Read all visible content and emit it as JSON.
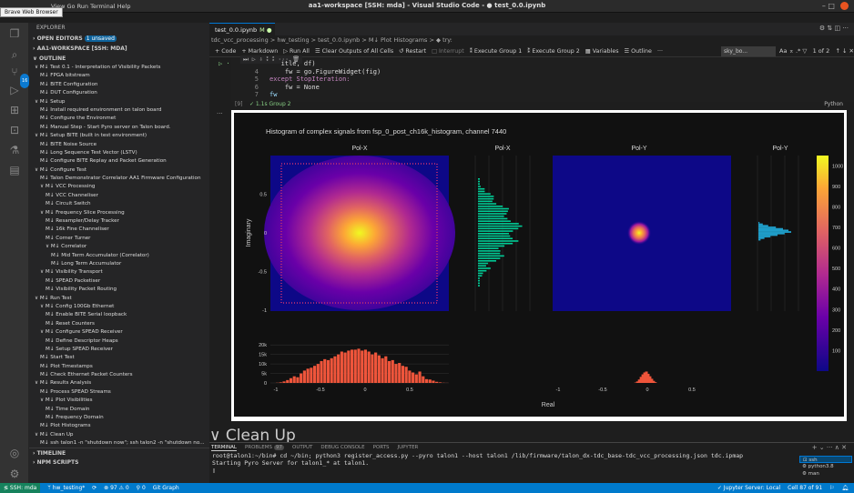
{
  "window": {
    "title": "aa1-workspace [SSH: mda] - Visual Studio Code - ● test_0.0.ipynb",
    "menu": [
      "File",
      "Edit",
      "Selection",
      "View",
      "Go",
      "Run",
      "Terminal",
      "Help"
    ],
    "menu_visible": "View  Go  Run  Terminal  Help",
    "tooltip": "Brave Web Browser",
    "controls": "–  □"
  },
  "activity": {
    "badge": "16"
  },
  "sidebar": {
    "header": "EXPLORER",
    "open_editors": "OPEN EDITORS",
    "unsaved": "1 unsaved",
    "workspace": "AA1-WORKSPACE [SSH: MDA]",
    "outline": "OUTLINE",
    "timeline": "TIMELINE",
    "npm": "NPM SCRIPTS",
    "outline_items": [
      {
        "i": 1,
        "t": "∨ M↓ Test 0.1 - Interpretation of Visibility Packets"
      },
      {
        "i": 2,
        "t": "M↓ FPGA bitstream"
      },
      {
        "i": 2,
        "t": "M↓ BITE Configuration"
      },
      {
        "i": 2,
        "t": "M↓ DUT Configuration"
      },
      {
        "i": 1,
        "t": "∨ M↓ Setup"
      },
      {
        "i": 2,
        "t": "M↓ Install required environment on talon board"
      },
      {
        "i": 2,
        "t": "M↓ Configure the Environmet"
      },
      {
        "i": 2,
        "t": "M↓ Manual Step - Start Pyro server on Talon board."
      },
      {
        "i": 1,
        "t": "∨ M↓ Setup BITE (built in test environment)"
      },
      {
        "i": 2,
        "t": "M↓ BITE Noise Source"
      },
      {
        "i": 2,
        "t": "M↓ Long Sequence Test Vector (LSTV)"
      },
      {
        "i": 2,
        "t": "M↓ Configure BITE Replay and Packet Generation"
      },
      {
        "i": 1,
        "t": "∨ M↓ Configure Test"
      },
      {
        "i": 2,
        "t": "M↓ Talon Demonstrator Correlator AA1 Firmware Configuration"
      },
      {
        "i": 2,
        "t": "∨ M↓ VCC Processing"
      },
      {
        "i": 3,
        "t": "M↓ VCC Channeliser"
      },
      {
        "i": 3,
        "t": "M↓ Circuit Switch"
      },
      {
        "i": 2,
        "t": "∨ M↓ Frequency Slice Processing"
      },
      {
        "i": 3,
        "t": "M↓ Resampler/Delay Tracker"
      },
      {
        "i": 3,
        "t": "M↓ 16k Fine Channeliser"
      },
      {
        "i": 3,
        "t": "M↓ Corner Turner"
      },
      {
        "i": 3,
        "t": "∨ M↓ Correlator"
      },
      {
        "i": 4,
        "t": "M↓ Mid Term Accumulator (Correlator)"
      },
      {
        "i": 4,
        "t": "M↓ Long Term Accumulator"
      },
      {
        "i": 2,
        "t": "∨ M↓ Visibility Transport"
      },
      {
        "i": 3,
        "t": "M↓ SPEAD Packetiser"
      },
      {
        "i": 3,
        "t": "M↓ Visibility Packet Routing"
      },
      {
        "i": 1,
        "t": "∨ M↓ Run Test"
      },
      {
        "i": 2,
        "t": "∨ M↓ Config 100Gb Ethernet"
      },
      {
        "i": 3,
        "t": "M↓ Enable BITE Serial loopback"
      },
      {
        "i": 3,
        "t": "M↓ Reset Counters"
      },
      {
        "i": 2,
        "t": "∨ M↓ Configure SPEAD Receiver"
      },
      {
        "i": 3,
        "t": "M↓ Define Descriptor Heaps"
      },
      {
        "i": 3,
        "t": "M↓ Setup SPEAD Receiver"
      },
      {
        "i": 2,
        "t": "M↓ Start Test"
      },
      {
        "i": 2,
        "t": "M↓ Plot Timestamps"
      },
      {
        "i": 2,
        "t": "M↓ Check Ethernet Packet Counters"
      },
      {
        "i": 1,
        "t": "∨ M↓ Results Analysis"
      },
      {
        "i": 2,
        "t": "M↓ Process SPEAD Streams"
      },
      {
        "i": 2,
        "t": "∨ M↓ Plot Visibilities"
      },
      {
        "i": 3,
        "t": "M↓ Time Domain"
      },
      {
        "i": 3,
        "t": "M↓ Frequency Domain"
      },
      {
        "i": 2,
        "t": "M↓ Plot Histograms"
      },
      {
        "i": 1,
        "t": "∨ M↓ Clean Up"
      },
      {
        "i": 2,
        "t": "M↓ ssh talon1 -n \"shutdown now\"; ssh talon2 -n \"shutdown no..."
      }
    ]
  },
  "editor": {
    "tab": "test_0.0.ipynb",
    "tab_mod": "M ●",
    "breadcrumb": "tdc_vcc_processing > hw_testing > test_0.0.ipynb > M↓ Plot Histograms > ◆ try:",
    "toolbar": [
      "+ Code",
      "+ Markdown",
      "▷ Run All",
      "☰ Clear Outputs of All Cells",
      "↺ Restart",
      "□ Interrupt",
      "⁑ Execute Group 1",
      "⁑ Execute Group 2",
      "▦ Variables",
      "☰ Outline",
      "···"
    ],
    "kernel": "sky_bo...",
    "find": "1 of 2",
    "code_lines": [
      {
        "n": "",
        "t": "   itle, df)"
      },
      {
        "n": "4",
        "t": "    fw = go.FigureWidget(fig)"
      },
      {
        "n": "5",
        "t": "except StopIteration:"
      },
      {
        "n": "6",
        "t": "    fw = None"
      },
      {
        "n": "7",
        "t": "fw"
      }
    ],
    "cell_status": "✓  1.1s  Group 2",
    "cell_exec": "[9]",
    "language": "Python",
    "next_heading": "Clean Up"
  },
  "chart_data": {
    "type": "heatmap",
    "title": "Histogram of complex signals from fsp_0_post_ch16k_histogram, channel 7440",
    "panels": [
      "Pol-X",
      "Pol-X",
      "Pol-Y",
      "Pol-Y"
    ],
    "xlabel": "Real",
    "ylabel": "Imaginary",
    "xlim": [
      -1,
      1
    ],
    "ylim": [
      -1,
      1
    ],
    "y_ticks": [
      "0.5",
      "0",
      "-0.5",
      "-1"
    ],
    "x_ticks": [
      "-1",
      "-0.5",
      "0",
      "0.5"
    ],
    "bottom_y_ticks": [
      "20k",
      "15k",
      "10k",
      "5k",
      "0"
    ],
    "colorbar_ticks": [
      "1000",
      "900",
      "800",
      "700",
      "600",
      "500",
      "400",
      "300",
      "200",
      "100"
    ],
    "colorbar_range": [
      0,
      1050
    ],
    "colors": {
      "polx": "#ef553b",
      "poly_hist": "#1f9ec9",
      "polx_side": "#00cc96",
      "bg": "#111111",
      "plot_bg": "#0d0887"
    },
    "polx_hist_values": [
      100,
      300,
      800,
      1500,
      2500,
      3500,
      3000,
      5000,
      6500,
      7500,
      8000,
      9000,
      10000,
      11500,
      12500,
      12000,
      13000,
      14000,
      15000,
      16500,
      16000,
      17000,
      17500,
      17500,
      18000,
      17000,
      17500,
      16500,
      15000,
      16000,
      14500,
      13000,
      14000,
      11500,
      12000,
      10000,
      10500,
      9000,
      8500,
      6500,
      5500,
      4500,
      6000,
      3500,
      2000,
      1800,
      1200,
      600,
      300,
      100,
      50
    ],
    "poly_hist_values": [
      200,
      800,
      1800,
      3200,
      4500,
      5500,
      6000,
      4800,
      3500,
      2200,
      1100,
      400
    ],
    "poly_hist_x": [
      -0.13,
      -0.11,
      -0.09,
      -0.07,
      -0.05,
      -0.03,
      -0.01,
      0.01,
      0.03,
      0.05,
      0.07,
      0.09
    ]
  },
  "panel": {
    "tabs": [
      "TERMINAL",
      "PROBLEMS",
      "97",
      "OUTPUT",
      "DEBUG CONSOLE",
      "PORTS",
      "JUPYTER"
    ],
    "terminal_lines": [
      "root@talon1:~/bin# cd ~/bin; python3 register_access.py --pyro talon1 --host talon1 /lib/firmware/talon_dx-tdc_base-tdc_vcc_processing.json tdc.ipmap",
      "Starting Pyro Server for talon1_* at talon1.",
      "▯"
    ],
    "terminal_list": [
      "ssh",
      "python3.8",
      "man"
    ]
  },
  "status": {
    "remote": "≶ SSH: mda",
    "branch": "ᛘ hw_testing*",
    "sync": "⟳",
    "problems": "⊗ 97 ⚠ 0",
    "ports": "⚲ 0",
    "git": "Git Graph",
    "jupyter": "✓ Jupyter Server: Local",
    "cell": "Cell 87 of 91"
  }
}
